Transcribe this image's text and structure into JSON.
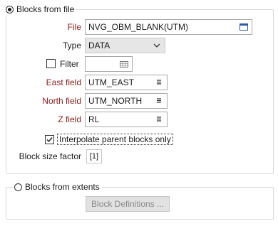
{
  "blocks_from_file": {
    "radio_label": "Blocks from file",
    "selected": true,
    "file": {
      "label": "File",
      "value": "NVG_OBM_BLANK(UTM)",
      "icon": "file-browse-icon"
    },
    "type": {
      "label": "Type",
      "value": "DATA",
      "icon": "chevron-down-icon"
    },
    "filter": {
      "label": "Filter",
      "checked": false,
      "value": "",
      "icon": "filter-builder-icon"
    },
    "east_field": {
      "label": "East field",
      "value": "UTM_EAST",
      "icon": "field-list-icon"
    },
    "north_field": {
      "label": "North field",
      "value": "UTM_NORTH",
      "icon": "field-list-icon"
    },
    "z_field": {
      "label": "Z field",
      "value": "RL",
      "icon": "field-list-icon"
    },
    "interpolate": {
      "label": "Interpolate parent blocks only",
      "checked": true
    },
    "block_size_factor": {
      "label": "Block size factor",
      "value": "[1]"
    }
  },
  "blocks_from_extents": {
    "radio_label": "Blocks from extents",
    "selected": false,
    "block_definitions_button": "Block Definitions ..."
  },
  "colors": {
    "required_label": "#8b1a1a",
    "disabled_text": "#8a8a8a"
  }
}
